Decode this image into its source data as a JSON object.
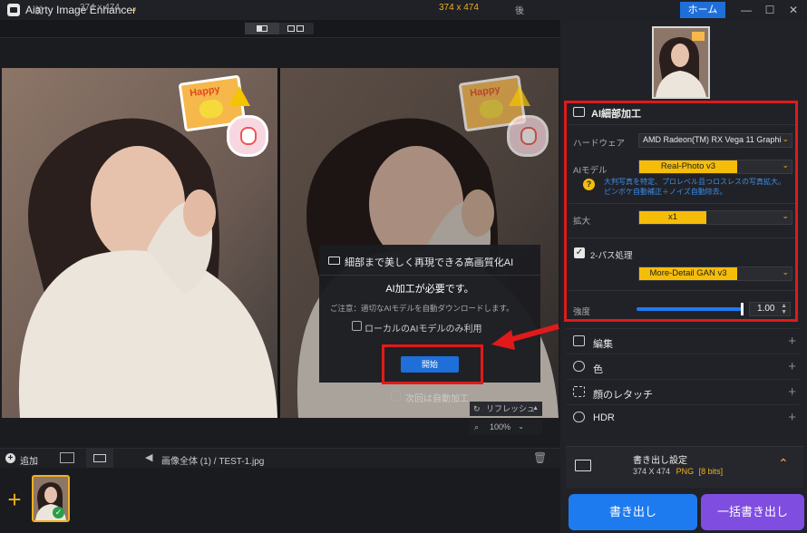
{
  "app": {
    "title": "Aiarty Image Enhancer",
    "home_label": "ホーム"
  },
  "compare": {
    "before_label": "前",
    "after_label": "後",
    "left_size": "374 x 474",
    "right_size": "374 x 474"
  },
  "dialog": {
    "header": "細部まで美しく再現できる高画質化AI",
    "title": "AI加工が必要です。",
    "note": "ご注意：適切なAIモデルを自動ダウンロードします。",
    "local_only_label": "ローカルのAIモデルのみ利用",
    "start_label": "開始",
    "auto_label": "次回は自動加工"
  },
  "canvas": {
    "refresh_label": "リフレッシュ",
    "zoom": "100%"
  },
  "bottom": {
    "add_label": "追加",
    "path": "画像全体 (1)  /  TEST-1.jpg"
  },
  "ai_panel": {
    "title": "AI細部加工",
    "hardware_label": "ハードウェア",
    "hardware_value": "AMD Radeon(TM) RX Vega 11 Graphi",
    "model_label": "AIモデル",
    "model_value": "Real-Photo  v3",
    "model_desc": "大判写真を特定、プロレベル且つロスレスの写真拡大。ピンボケ自動補正＋ノイズ自動除去。",
    "scale_label": "拡大",
    "scale_value": "x1",
    "two_pass_label": "2-パス処理",
    "two_pass_value": "More-Detail GAN  v3",
    "strength_label": "強度",
    "strength_value": "1.00",
    "strength_fraction": 0.98
  },
  "sections": [
    {
      "label": "編集"
    },
    {
      "label": "色"
    },
    {
      "label": "顔のレタッチ"
    },
    {
      "label": "HDR"
    }
  ],
  "export": {
    "title": "書き出し設定",
    "size": "374 X 474",
    "format": "PNG",
    "bits": "[8 bits]",
    "export_label": "書き出し",
    "batch_label": "一括書き出し"
  },
  "colors": {
    "accent_blue": "#1e6fd9",
    "accent_yellow": "#f5bd0a",
    "highlight_red": "#e01a1a",
    "batch_purple": "#7f4de0"
  }
}
